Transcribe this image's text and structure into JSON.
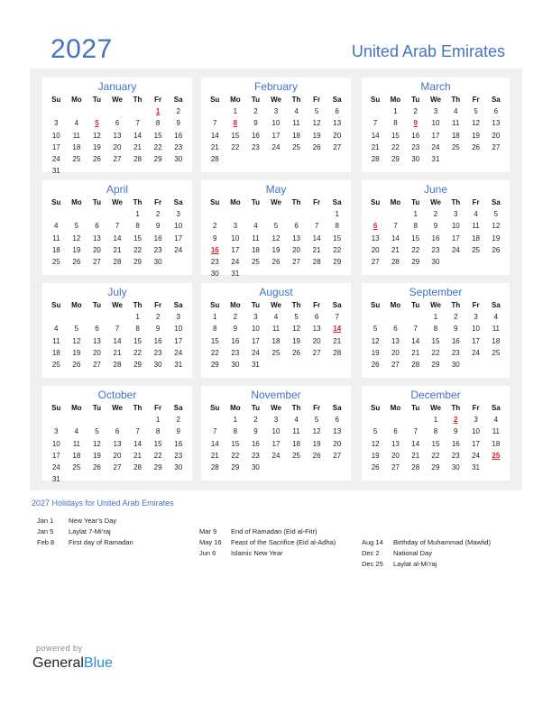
{
  "header": {
    "year": "2027",
    "country": "United Arab Emirates"
  },
  "colors": {
    "accent": "#4472c4",
    "holiday": "#e0202a",
    "panel_bg": "#f0f0f0",
    "brand_blue": "#2d8ad6"
  },
  "weekday_labels": [
    "Su",
    "Mo",
    "Tu",
    "We",
    "Th",
    "Fr",
    "Sa"
  ],
  "months": [
    {
      "name": "January",
      "first_weekday": 5,
      "days": 31,
      "holidays": [
        1,
        5
      ]
    },
    {
      "name": "February",
      "first_weekday": 1,
      "days": 28,
      "holidays": [
        8
      ]
    },
    {
      "name": "March",
      "first_weekday": 1,
      "days": 31,
      "holidays": [
        9
      ]
    },
    {
      "name": "April",
      "first_weekday": 4,
      "days": 30,
      "holidays": []
    },
    {
      "name": "May",
      "first_weekday": 6,
      "days": 31,
      "holidays": [
        16
      ]
    },
    {
      "name": "June",
      "first_weekday": 2,
      "days": 30,
      "holidays": [
        6
      ]
    },
    {
      "name": "July",
      "first_weekday": 4,
      "days": 31,
      "holidays": []
    },
    {
      "name": "August",
      "first_weekday": 0,
      "days": 31,
      "holidays": [
        14
      ]
    },
    {
      "name": "September",
      "first_weekday": 3,
      "days": 30,
      "holidays": []
    },
    {
      "name": "October",
      "first_weekday": 5,
      "days": 31,
      "holidays": []
    },
    {
      "name": "November",
      "first_weekday": 1,
      "days": 30,
      "holidays": []
    },
    {
      "name": "December",
      "first_weekday": 3,
      "days": 31,
      "holidays": [
        2,
        25
      ]
    }
  ],
  "holidays_section": {
    "title": "2027 Holidays for United Arab Emirates",
    "columns": [
      [
        {
          "date": "Jan 1",
          "name": "New Year’s Day"
        },
        {
          "date": "Jan 5",
          "name": "Laylat 7-Mi’raj"
        },
        {
          "date": "Feb 8",
          "name": "First day of Ramadan"
        }
      ],
      [
        {
          "date": "Mar 9",
          "name": "End of Ramadan (Eid al-Fitr)"
        },
        {
          "date": "May 16",
          "name": "Feast of the Sacrifice (Eid al-Adha)"
        },
        {
          "date": "Jun 6",
          "name": "Islamic New Year"
        }
      ],
      [
        {
          "date": "Aug 14",
          "name": "Birthday of Muhammad (Mawlid)"
        },
        {
          "date": "Dec 2",
          "name": "National Day"
        },
        {
          "date": "Dec 25",
          "name": "Laylat al-Mi’raj"
        }
      ]
    ]
  },
  "footer": {
    "powered_by": "powered by",
    "brand_part1": "General",
    "brand_part2": "Blue"
  }
}
